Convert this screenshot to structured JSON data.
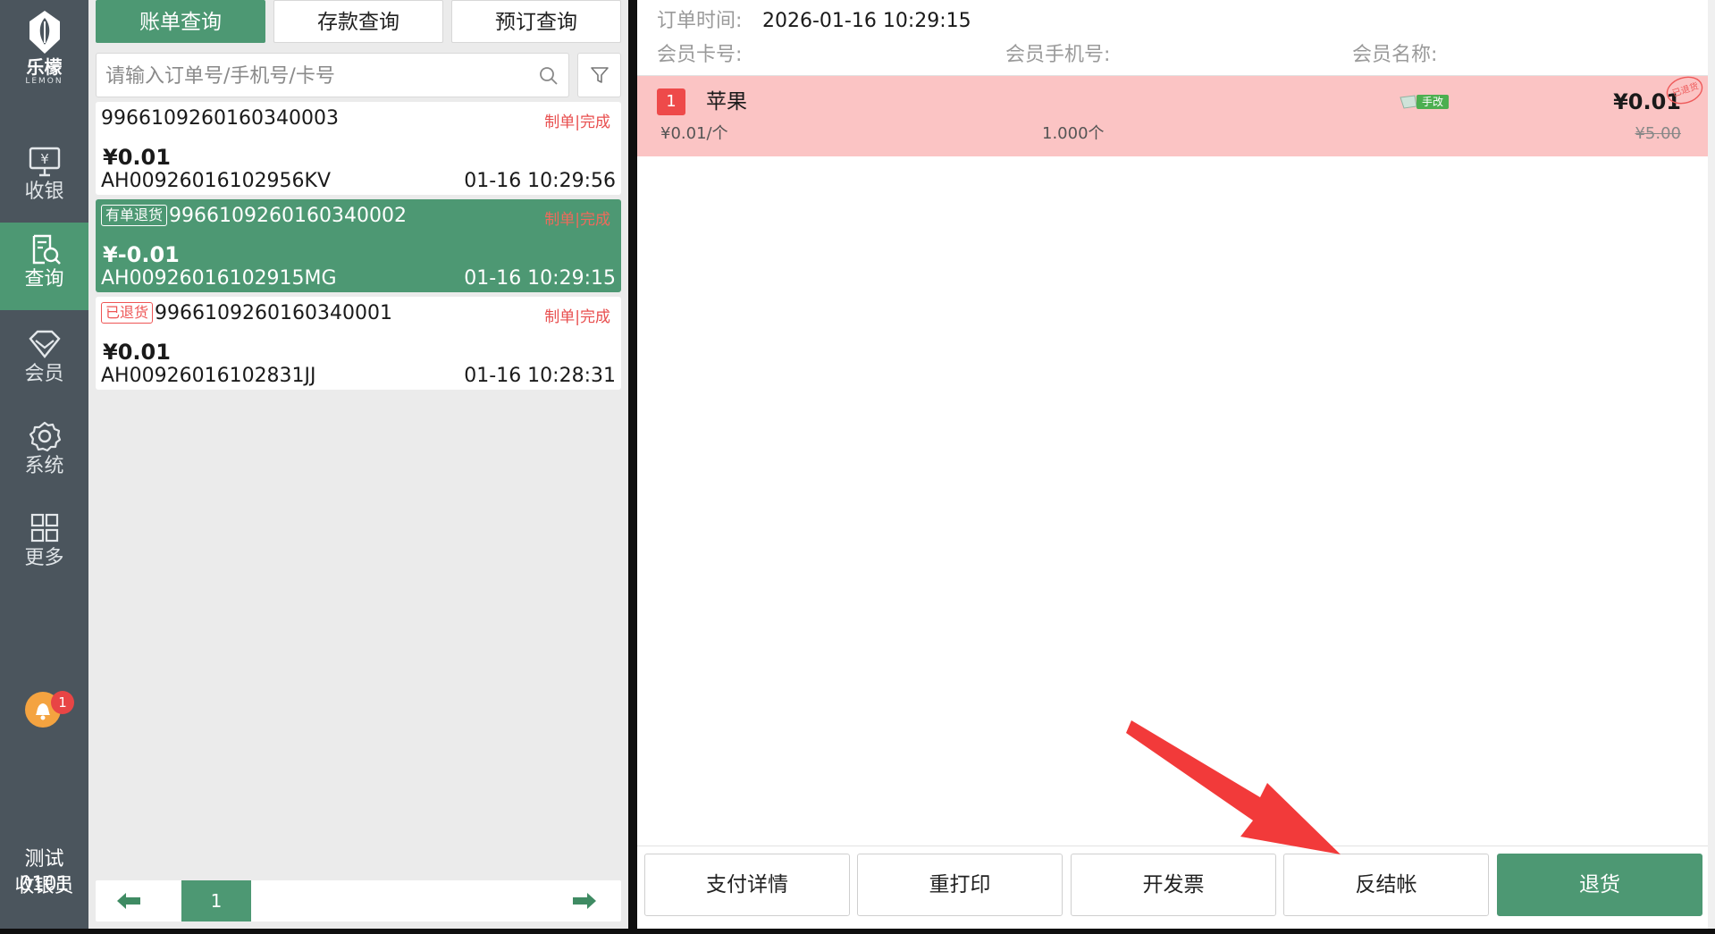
{
  "sidebar": {
    "logo_cn": "乐檬",
    "logo_en": "LEMON",
    "items": [
      {
        "label": "收银",
        "icon": "cashier-monitor-icon"
      },
      {
        "label": "查询",
        "icon": "query-search-icon",
        "active": true
      },
      {
        "label": "会员",
        "icon": "member-diamond-icon"
      },
      {
        "label": "系统",
        "icon": "gear-icon"
      },
      {
        "label": "更多",
        "icon": "grid-icon"
      }
    ],
    "notification_count": "1",
    "user_name": "测试0101",
    "user_role": "收银员"
  },
  "tabs": [
    "账单查询",
    "存款查询",
    "预订查询"
  ],
  "active_tab": "账单查询",
  "search": {
    "placeholder": "请输入订单号/手机号/卡号",
    "value": ""
  },
  "orders": [
    {
      "order_no": "9966109260160340003",
      "tag": "",
      "status": "制单|完成",
      "amount": "¥0.01",
      "code": "AH00926016102956KV",
      "time": "01-16 10:29:56",
      "selected": false
    },
    {
      "order_no": "9966109260160340002",
      "tag": "有单退货",
      "status": "制单|完成",
      "amount": "¥-0.01",
      "code": "AH00926016102915MG",
      "time": "01-16 10:29:15",
      "selected": true
    },
    {
      "order_no": "9966109260160340001",
      "tag": "已退货",
      "status": "制单|完成",
      "amount": "¥0.01",
      "code": "AH00926016102831JJ",
      "time": "01-16 10:28:31",
      "selected": false
    }
  ],
  "pager": {
    "page": "1"
  },
  "detail": {
    "order_time_label": "订单时间:",
    "order_time": "2026-01-16 10:29:15",
    "card_label": "会员卡号:",
    "phone_label": "会员手机号:",
    "name_label": "会员名称:",
    "items": [
      {
        "index": "1",
        "name": "苹果",
        "unit_price": "¥0.01/个",
        "qty": "1.000个",
        "tag": "手改",
        "price": "¥0.01",
        "orig_price": "¥5.00",
        "stamp": "已退货"
      }
    ]
  },
  "actions": [
    "支付详情",
    "重打印",
    "开发票",
    "反结帐",
    "退货"
  ],
  "colors": {
    "primary_green": "#4d9873",
    "sidebar_bg": "#4b555d",
    "row_highlight": "#fbc4c4",
    "alert_red": "#ee4a4a",
    "arrow_red": "#f23a3a"
  }
}
